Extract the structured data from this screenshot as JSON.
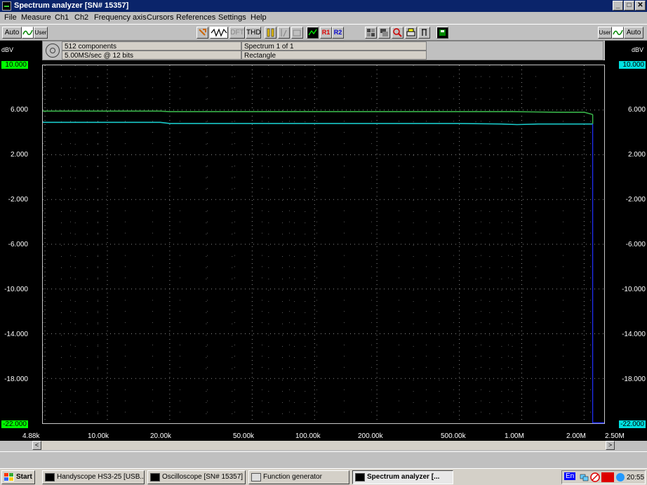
{
  "window": {
    "title": "Spectrum analyzer  [SN# 15357]",
    "controls": {
      "minimize": "_",
      "maximize": "□",
      "close": "✕"
    }
  },
  "menu": [
    "File",
    "Measure",
    "Ch1",
    "Ch2",
    "Frequency axis",
    "Cursors",
    "References",
    "Settings",
    "Help"
  ],
  "toolbar": {
    "left_auto": "Auto",
    "left_user": "User",
    "right_user": "User",
    "right_auto": "Auto",
    "dft": "DFT",
    "thd": "THD",
    "r1": "R1",
    "r2": "R2"
  },
  "info": {
    "components": "512 components",
    "rate": "5.00MS/sec @ 12 bits",
    "spectrum": "Spectrum 1 of 1",
    "window": "Rectangle"
  },
  "axis": {
    "left_unit": "dBV",
    "right_unit": "dBV",
    "y_ticks": [
      "10.000",
      "6.000",
      "2.000",
      "-2.000",
      "-6.000",
      "-10.000",
      "-14.000",
      "-18.000",
      "-22.000"
    ],
    "x_ticks": [
      "4.88k",
      "10.00k",
      "20.00k",
      "50.00k",
      "100.00k",
      "200.00k",
      "500.00k",
      "1.00M",
      "2.00M",
      "2.50M"
    ]
  },
  "colors": {
    "ch1": "#39b54a",
    "ch2": "#19c8c8",
    "cursor": "#2030ff",
    "grid": "#9a9a9a",
    "plot_bg": "#000000"
  },
  "chart_data": {
    "type": "line",
    "xlabel": "",
    "ylabel": "dBV",
    "xscale": "log",
    "xlim": [
      4880,
      2500000
    ],
    "ylim": [
      -22,
      10
    ],
    "grid": true,
    "series": [
      {
        "x": [
          4880,
          18000,
          20000,
          100000,
          500000,
          900000,
          1500000,
          2000000,
          2200000
        ],
        "y": [
          5.9,
          5.9,
          5.85,
          5.85,
          5.85,
          5.85,
          5.8,
          5.8,
          5.6
        ]
      },
      {
        "x": [
          4880,
          18000,
          20000,
          100000,
          500000,
          800000,
          950000,
          1200000,
          2000000,
          2200000
        ],
        "y": [
          4.9,
          4.9,
          4.8,
          4.8,
          4.8,
          4.75,
          4.7,
          4.75,
          4.75,
          4.75
        ]
      }
    ],
    "cursor_x": 2200000
  },
  "scroll": {
    "left": "<",
    "right": ">"
  },
  "taskbar": {
    "start": "Start",
    "tasks": [
      "Handyscope HS3-25 [USB...",
      "Oscilloscope  [SN# 15357]",
      "Function generator",
      "Spectrum analyzer  [..."
    ],
    "tray_en": "En",
    "clock": "20:55"
  }
}
